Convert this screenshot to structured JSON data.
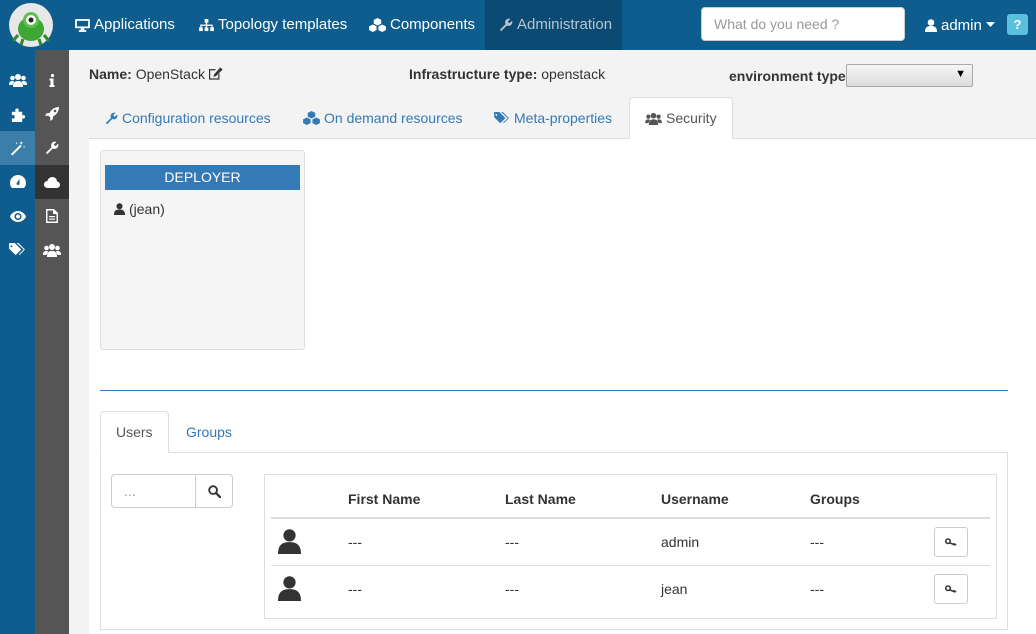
{
  "navbar": {
    "items": [
      {
        "label": "Applications",
        "icon": "desktop-icon"
      },
      {
        "label": "Topology templates",
        "icon": "sitemap-icon"
      },
      {
        "label": "Components",
        "icon": "cubes-icon"
      },
      {
        "label": "Administration",
        "icon": "wrench-icon"
      }
    ],
    "search_placeholder": "What do you need ?",
    "user_label": "admin",
    "help_label": "?"
  },
  "header": {
    "name_label": "Name:",
    "name_value": "OpenStack",
    "infra_label": "Infrastructure type:",
    "infra_value": "openstack",
    "env_label": "environment type:",
    "env_value": ""
  },
  "tabs": [
    {
      "label": "Configuration resources",
      "icon": "wrench-icon"
    },
    {
      "label": "On demand resources",
      "icon": "cubes-icon"
    },
    {
      "label": "Meta-properties",
      "icon": "tags-icon"
    },
    {
      "label": "Security",
      "icon": "users-icon"
    }
  ],
  "role": {
    "title": "DEPLOYER",
    "user": "(jean)"
  },
  "sub_tabs": [
    {
      "label": "Users"
    },
    {
      "label": "Groups"
    }
  ],
  "users_search_placeholder": "...",
  "users_table": {
    "columns": [
      "First Name",
      "Last Name",
      "Username",
      "Groups"
    ],
    "rows": [
      {
        "first_name": "---",
        "last_name": "---",
        "username": "admin",
        "groups": "---"
      },
      {
        "first_name": "---",
        "last_name": "---",
        "username": "jean",
        "groups": "---"
      }
    ]
  },
  "colors": {
    "navbar": "#0e5d8e",
    "accent": "#337ab7",
    "sidebar_dark": "#555555"
  }
}
